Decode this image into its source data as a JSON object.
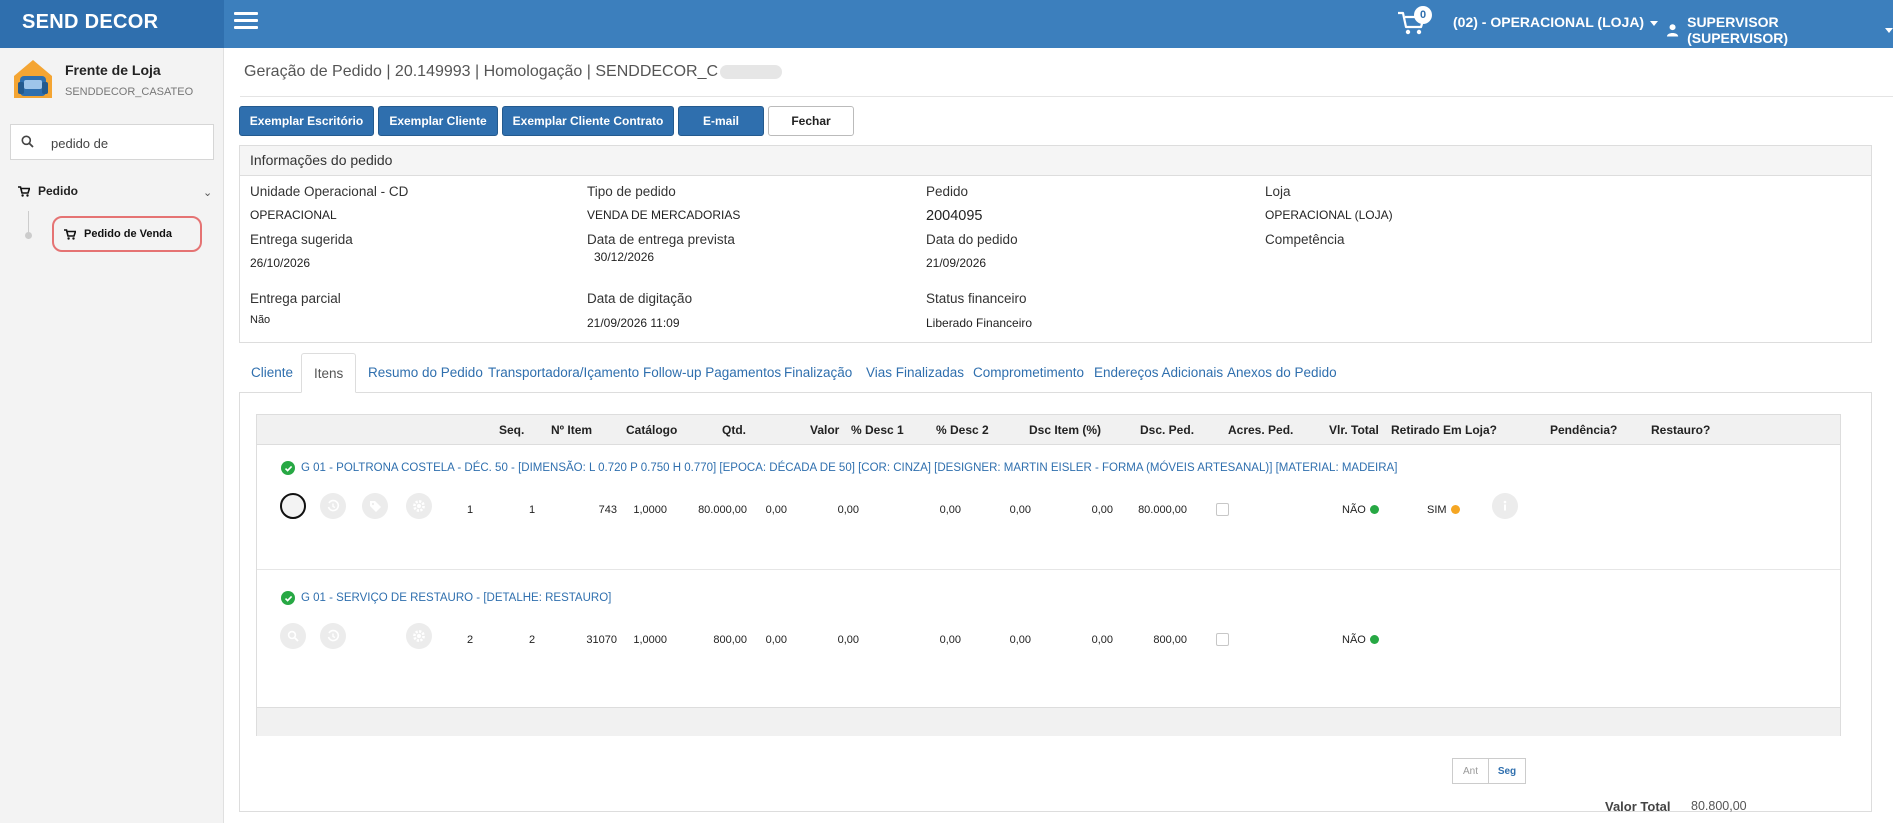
{
  "app": {
    "brand": "SEND DECOR",
    "cart_count": "0",
    "unit_menu": "(02) - OPERACIONAL (LOJA)",
    "user_menu": "SUPERVISOR (SUPERVISOR)"
  },
  "sidebar": {
    "store_name": "Frente de Loja",
    "store_code": "SENDDECOR_CASATEO",
    "search_value": "pedido de",
    "group_label": "Pedido",
    "item_label": "Pedido de Venda"
  },
  "page": {
    "breadcrumb": "Geração de Pedido | 20.149993 | Homologação | SENDDECOR_C"
  },
  "actions": {
    "office_copy": "Exemplar Escritório",
    "client_copy": "Exemplar Cliente",
    "contract_copy": "Exemplar Cliente Contrato",
    "email": "E-mail",
    "close": "Fechar"
  },
  "order_info": {
    "heading": "Informações do pedido",
    "fields": {
      "unit_label": "Unidade Operacional - CD",
      "unit_value": "OPERACIONAL",
      "type_label": "Tipo de pedido",
      "type_value": "VENDA DE MERCADORIAS",
      "order_label": "Pedido",
      "order_value": "2004095",
      "store_label": "Loja",
      "store_value": "OPERACIONAL (LOJA)",
      "suggested_label": "Entrega sugerida",
      "suggested_value": "26/10/2026",
      "expected_label": "Data de entrega prevista",
      "expected_value": "30/12/2026",
      "order_date_label": "Data do pedido",
      "order_date_value": "21/09/2026",
      "competence_label": "Competência",
      "partial_label": "Entrega parcial",
      "partial_value": "Não",
      "typing_label": "Data de digitação",
      "typing_value": "21/09/2026 11:09",
      "fin_status_label": "Status financeiro",
      "fin_status_value": "Liberado Financeiro"
    }
  },
  "tabs": [
    "Cliente",
    "Itens",
    "Resumo do Pedido",
    "Transportadora/Içamento",
    "Follow-up Pagamentos",
    "Finalização",
    "Vias Finalizadas",
    "Comprometimento",
    "Endereços Adicionais",
    "Anexos do Pedido"
  ],
  "table": {
    "headers": {
      "seq": "Seq.",
      "item_no": "Nº Item",
      "catalog": "Catálogo",
      "qty": "Qtd.",
      "value": "Valor",
      "disc1": "% Desc 1",
      "disc2": "% Desc 2",
      "item_disc": "Dsc Item (%)",
      "order_disc": "Dsc. Ped.",
      "order_add": "Acres. Ped.",
      "total": "Vlr. Total",
      "pickup": "Retirado Em Loja?",
      "pending": "Pendência?",
      "restore": "Restauro?"
    },
    "rows": [
      {
        "title": "G 01 - POLTRONA COSTELA - DÉC. 50 - [DIMENSÃO: L 0.720 P 0.750 H 0.770] [EPOCA: DÉCADA DE 50] [COR: CINZA] [DESIGNER: MARTIN EISLER - FORMA (MÓVEIS ARTESANAL)] [MATERIAL: MADEIRA]",
        "seq": "1",
        "item_no": "1",
        "catalog": "743",
        "qty": "1,0000",
        "value": "80.000,00",
        "disc1": "0,00",
        "disc2": "0,00",
        "item_disc": "0,00",
        "order_disc": "0,00",
        "order_add": "0,00",
        "total": "80.000,00",
        "pending": "NÃO",
        "restore": "SIM"
      },
      {
        "title": "G 01 - SERVIÇO DE RESTAURO - [DETALHE: RESTAURO]",
        "seq": "2",
        "item_no": "2",
        "catalog": "31070",
        "qty": "1,0000",
        "value": "800,00",
        "disc1": "0,00",
        "disc2": "0,00",
        "item_disc": "0,00",
        "order_disc": "0,00",
        "order_add": "0,00",
        "total": "800,00",
        "pending": "NÃO"
      }
    ],
    "pager": {
      "prev": "Ant",
      "next": "Seg"
    }
  },
  "totals": {
    "label": "Valor Total",
    "value": "80.800,00"
  },
  "colors": {
    "header_blue": "#3c7fbd",
    "primary_blue": "#2f6fae",
    "ok_green": "#27a844",
    "warn_orange": "#f5a623",
    "highlight_red": "#e57373"
  }
}
